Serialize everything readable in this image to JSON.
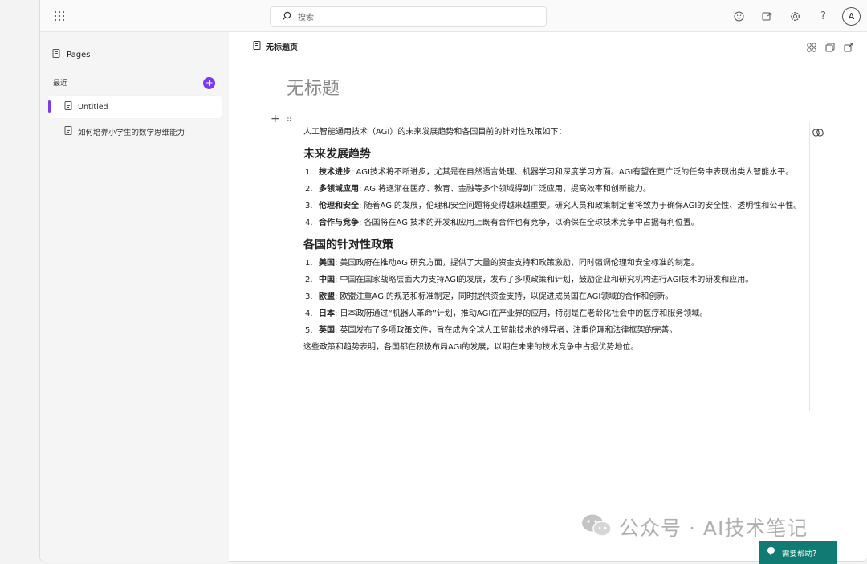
{
  "topbar": {
    "search_placeholder": "搜索",
    "avatar_initial": "A",
    "icons": [
      "apps-icon",
      "search-icon",
      "emoji-icon",
      "share-icon",
      "gear-icon",
      "help-icon"
    ]
  },
  "sidebar": {
    "pages_label": "Pages",
    "recent_label": "最近",
    "add_symbol": "+",
    "items": [
      {
        "label": "Untitled",
        "active": true
      },
      {
        "label": "如何培养小学生的数学思维能力",
        "active": false
      }
    ]
  },
  "main": {
    "breadcrumb": "无标题页",
    "page_title": "无标题",
    "intro": "人工智能通用技术（AGI）的未来发展趋势和各国目前的针对性政策如下：",
    "section1": {
      "heading": "未来发展趋势",
      "items": [
        {
          "num": "1.",
          "term": "技术进步",
          "text": ": AGI技术将不断进步，尤其是在自然语言处理、机器学习和深度学习方面。AGI有望在更广泛的任务中表现出类人智能水平。"
        },
        {
          "num": "2.",
          "term": "多领域应用",
          "text": ": AGI将逐渐在医疗、教育、金融等多个领域得到广泛应用，提高效率和创新能力。"
        },
        {
          "num": "3.",
          "term": "伦理和安全",
          "text": ": 随着AGI的发展，伦理和安全问题将变得越来越重要。研究人员和政策制定者将致力于确保AGI的安全性、透明性和公平性。"
        },
        {
          "num": "4.",
          "term": "合作与竞争",
          "text": ": 各国将在AGI技术的开发和应用上既有合作也有竞争，以确保在全球技术竞争中占据有利位置。"
        }
      ]
    },
    "section2": {
      "heading": "各国的针对性政策",
      "items": [
        {
          "num": "1.",
          "term": "美国",
          "text": ": 美国政府在推动AGI研究方面，提供了大量的资金支持和政策激励，同时强调伦理和安全标准的制定。"
        },
        {
          "num": "2.",
          "term": "中国",
          "text": ": 中国在国家战略层面大力支持AGI的发展，发布了多项政策和计划，鼓励企业和研究机构进行AGI技术的研发和应用。"
        },
        {
          "num": "3.",
          "term": "欧盟",
          "text": ": 欧盟注重AGI的规范和标准制定，同时提供资金支持，以促进成员国在AGI领域的合作和创新。"
        },
        {
          "num": "4.",
          "term": "日本",
          "text": ": 日本政府通过“机器人革命”计划，推动AGI在产业界的应用，特别是在老龄化社会中的医疗和服务领域。"
        },
        {
          "num": "5.",
          "term": "英国",
          "text": ": 英国发布了多项政策文件，旨在成为全球人工智能技术的领导者，注重伦理和法律框架的完善。"
        }
      ]
    },
    "conclusion": "这些政策和趋势表明，各国都在积极布局AGI的发展，以期在未来的技术竞争中占据优势地位。"
  },
  "watermark": "公众号 · AI技术笔记",
  "help_label": "需要帮助?"
}
